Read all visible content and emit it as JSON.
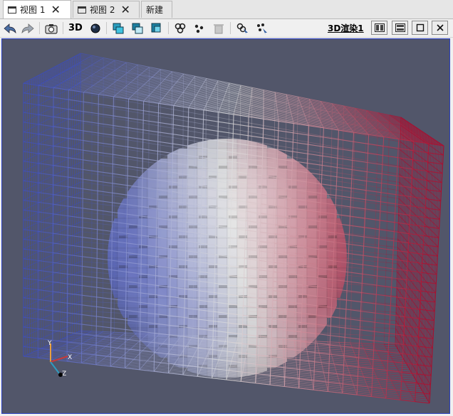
{
  "tabs": [
    {
      "label": "视图 1",
      "active": true,
      "closable": true
    },
    {
      "label": "视图 2",
      "active": false,
      "closable": true
    },
    {
      "label": "新建",
      "active": false,
      "closable": false
    }
  ],
  "toolbar": {
    "mode_3d_label": "3D",
    "render_view_label": "3D渲染1",
    "icons": [
      "undo-camera-icon",
      "redo-camera-icon",
      "screenshot-icon",
      "3d-toggle",
      "sphere-icon",
      "select-cells-on-icon",
      "select-points-on-icon",
      "select-cells-through-icon",
      "select-cells-polygon-icon",
      "select-points-polygon-icon",
      "clear-selection-icon",
      "interactive-select-cells-icon",
      "interactive-select-points-icon",
      "split-horizontal-icon",
      "split-vertical-icon",
      "maximize-icon",
      "close-icon"
    ]
  },
  "viewport": {
    "background": "#52566a",
    "axes": {
      "x": "X",
      "y": "Y",
      "z": "Z"
    },
    "colormap": [
      "#3b4cc0",
      "#dddddd",
      "#b40426"
    ]
  }
}
